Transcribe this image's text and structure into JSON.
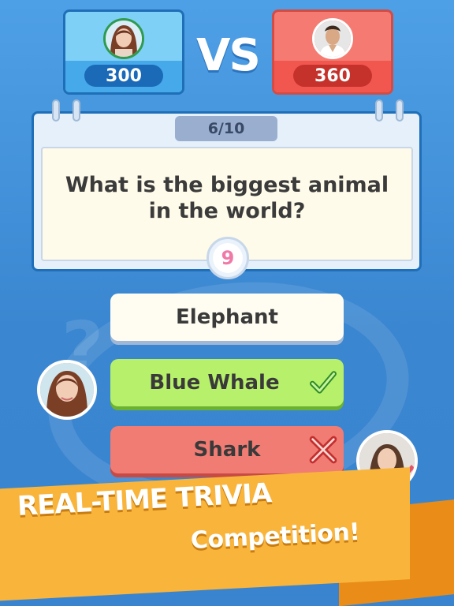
{
  "player_left": {
    "score": "300"
  },
  "player_right": {
    "score": "360"
  },
  "vs_label": "VS",
  "question": {
    "counter": "6/10",
    "text": "What is the biggest animal in the world?",
    "timer": "9"
  },
  "answers": [
    {
      "label": "Elephant",
      "state": "neutral"
    },
    {
      "label": "Blue Whale",
      "state": "correct",
      "icon": "checkmark-icon"
    },
    {
      "label": "Shark",
      "state": "wrong",
      "icon": "cross-icon"
    }
  ],
  "banner": {
    "line1": "REAL-TIME TRIVIA",
    "line2": "Competition!"
  },
  "colors": {
    "background": "#3f8fd6",
    "left_card": "#7fd0f6",
    "right_card": "#f57a72",
    "correct": "#b7f06a",
    "wrong": "#f17c74",
    "banner": "#f9b53b",
    "timer_digit": "#f07aa7"
  }
}
